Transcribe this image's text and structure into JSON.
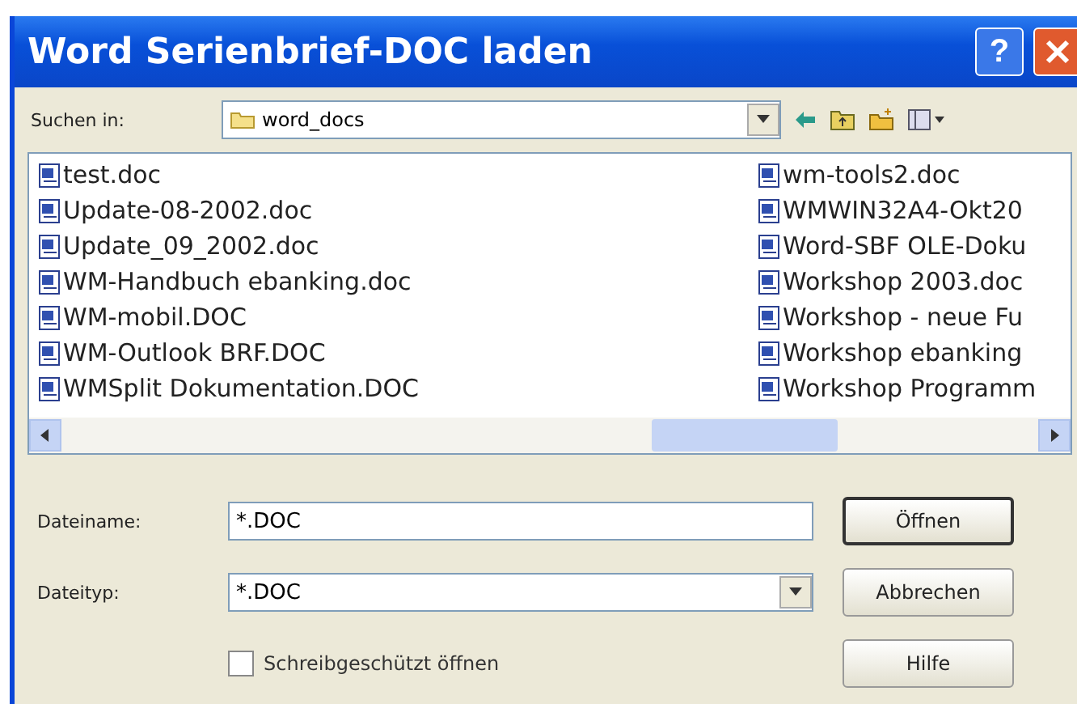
{
  "window": {
    "title": "Word Serienbrief-DOC laden",
    "buttons": [
      {
        "kind": "help",
        "label": "?"
      },
      {
        "kind": "close"
      }
    ]
  },
  "look_in": {
    "label": "Suchen in:",
    "value": "word_docs"
  },
  "files": [
    {
      "name": "test.doc"
    },
    {
      "name": "Update-08-2002.doc"
    },
    {
      "name": "Update_09_2002.doc"
    },
    {
      "name": "WM-Handbuch ebanking.doc"
    },
    {
      "name": "WM-mobil.DOC"
    },
    {
      "name": "WM-Outlook BRF.DOC"
    },
    {
      "name": "WMSplit Dokumentation.DOC"
    },
    {
      "name": "wm-tools2.doc"
    },
    {
      "name": "WMWIN32A4-Okt20"
    },
    {
      "name": "Word-SBF OLE-Doku"
    },
    {
      "name": "Workshop 2003.doc"
    },
    {
      "name": "Workshop - neue Fu"
    },
    {
      "name": "Workshop ebanking"
    },
    {
      "name": "Workshop Programm"
    }
  ],
  "filename": {
    "label": "Dateiname:",
    "value": "*.DOC"
  },
  "filetype": {
    "label": "Dateityp:",
    "value": "*.DOC"
  },
  "readonly": {
    "label": "Schreibgeschützt öffnen",
    "checked": false
  },
  "buttons": [
    {
      "label": "Öffnen",
      "default": true
    },
    {
      "label": "Abbrechen",
      "default": false
    },
    {
      "label": "Hilfe",
      "default": false
    }
  ]
}
